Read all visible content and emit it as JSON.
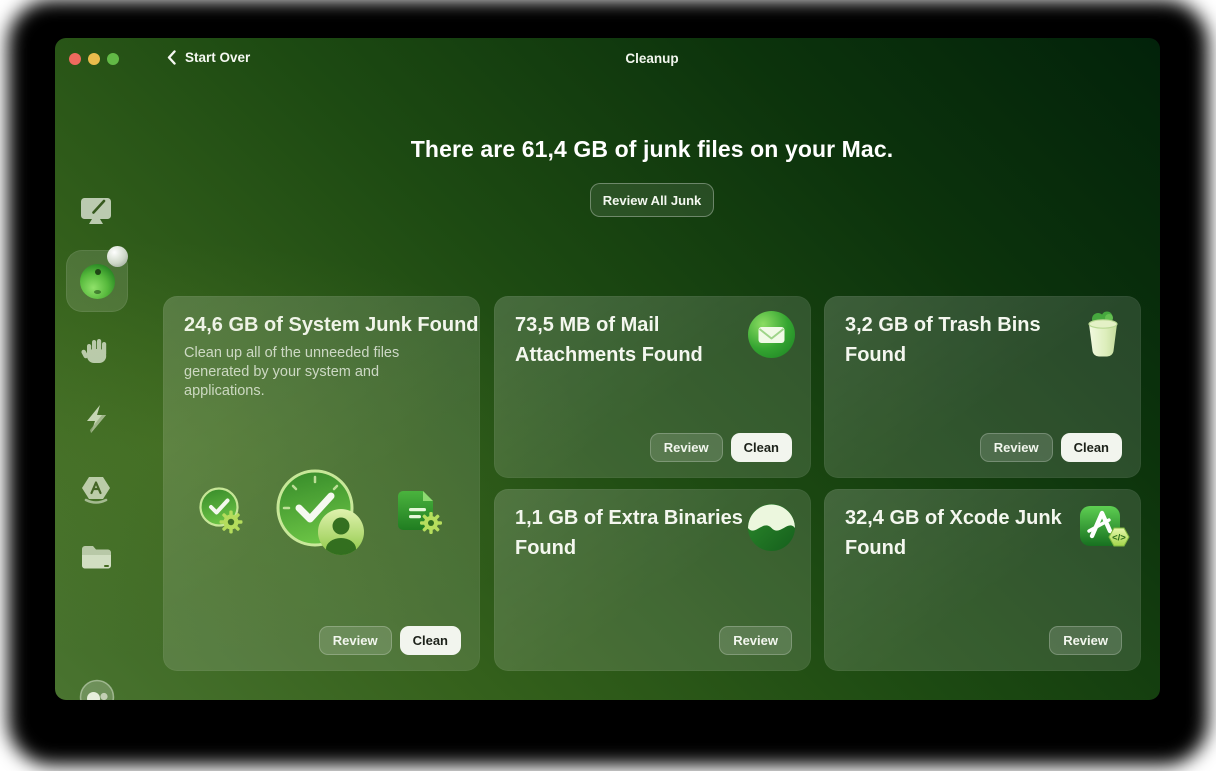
{
  "titlebar": {
    "back_label": "Start Over",
    "title": "Cleanup"
  },
  "hero": {
    "headline": "There are 61,4 GB of junk files on your Mac.",
    "review_all_label": "Review All Junk"
  },
  "sidebar": {
    "items": [
      {
        "id": "smart-care",
        "icon": "imac-cleaner-icon",
        "selected": false
      },
      {
        "id": "cleanup",
        "icon": "cleanup-sphere-icon",
        "selected": true,
        "has_badge": true
      },
      {
        "id": "protection",
        "icon": "hand-icon",
        "selected": false
      },
      {
        "id": "performance",
        "icon": "lightning-icon",
        "selected": false
      },
      {
        "id": "applications",
        "icon": "app-store-icon",
        "selected": false
      },
      {
        "id": "files",
        "icon": "folder-icon",
        "selected": false
      }
    ],
    "footer_icon": "assistant-avatar-icon"
  },
  "cards": [
    {
      "title": "24,6 GB of System Junk Found",
      "description": "Clean up all of the unneeded files generated by your system and applications.",
      "icons": [
        "clock-gear-icon",
        "clock-user-icon",
        "document-gear-icon"
      ],
      "review_label": "Review",
      "clean_label": "Clean"
    },
    {
      "title": "73,5 MB of Mail Attachments Found",
      "icon": "mail-icon",
      "review_label": "Review",
      "clean_label": "Clean"
    },
    {
      "title": "3,2 GB of Trash Bins Found",
      "icon": "trash-bin-icon",
      "review_label": "Review",
      "clean_label": "Clean"
    },
    {
      "title": "1,1 GB of Extra Binaries Found",
      "icon": "binaries-icon",
      "review_label": "Review"
    },
    {
      "title": "32,4 GB of Xcode Junk Found",
      "icon": "xcode-icon",
      "review_label": "Review"
    }
  ],
  "colors": {
    "window_gradient_light": "#4a7430",
    "window_gradient_dark": "#02220a",
    "card_overlay": "rgba(255,255,255,0.13)",
    "clean_button_bg": "#f2f5ee",
    "clean_button_text": "#1d221a",
    "traffic_red": "#ee6a5e",
    "traffic_yellow": "#e9bc4c",
    "traffic_green": "#62ba46"
  }
}
